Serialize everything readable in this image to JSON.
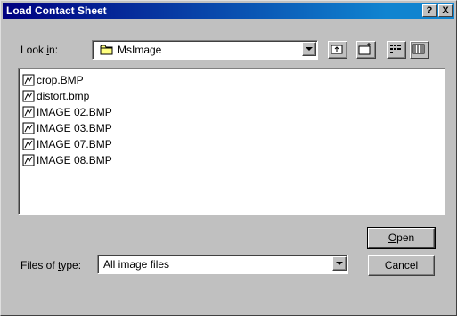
{
  "window": {
    "title": "Load Contact Sheet",
    "help_glyph": "?",
    "close_glyph": "X"
  },
  "look_in": {
    "label_prefix": "Look ",
    "label_mnemonic": "i",
    "label_suffix": "n:",
    "value": "MsImage",
    "folder_icon": "folder-icon"
  },
  "toolbar": {
    "buttons": [
      {
        "name": "up-one-level-button",
        "icon": "up-folder-icon"
      },
      {
        "name": "create-new-folder-button",
        "icon": "new-folder-icon"
      },
      {
        "name": "list-view-button",
        "icon": "list-view-icon"
      },
      {
        "name": "details-view-button",
        "icon": "details-view-icon"
      }
    ]
  },
  "files": [
    {
      "name": "crop.BMP"
    },
    {
      "name": "distort.bmp"
    },
    {
      "name": "IMAGE 02.BMP"
    },
    {
      "name": "IMAGE 03.BMP"
    },
    {
      "name": "IMAGE 07.BMP"
    },
    {
      "name": "IMAGE 08.BMP"
    }
  ],
  "file_type": {
    "label_prefix": "Files of ",
    "label_mnemonic": "t",
    "label_suffix": "ype:",
    "value": "All image files"
  },
  "buttons": {
    "open_mnemonic": "O",
    "open_rest": "pen",
    "cancel": "Cancel"
  },
  "colors": {
    "titlebar": "#000080",
    "face": "#c0c0c0",
    "window_bg": "#ffffff"
  }
}
